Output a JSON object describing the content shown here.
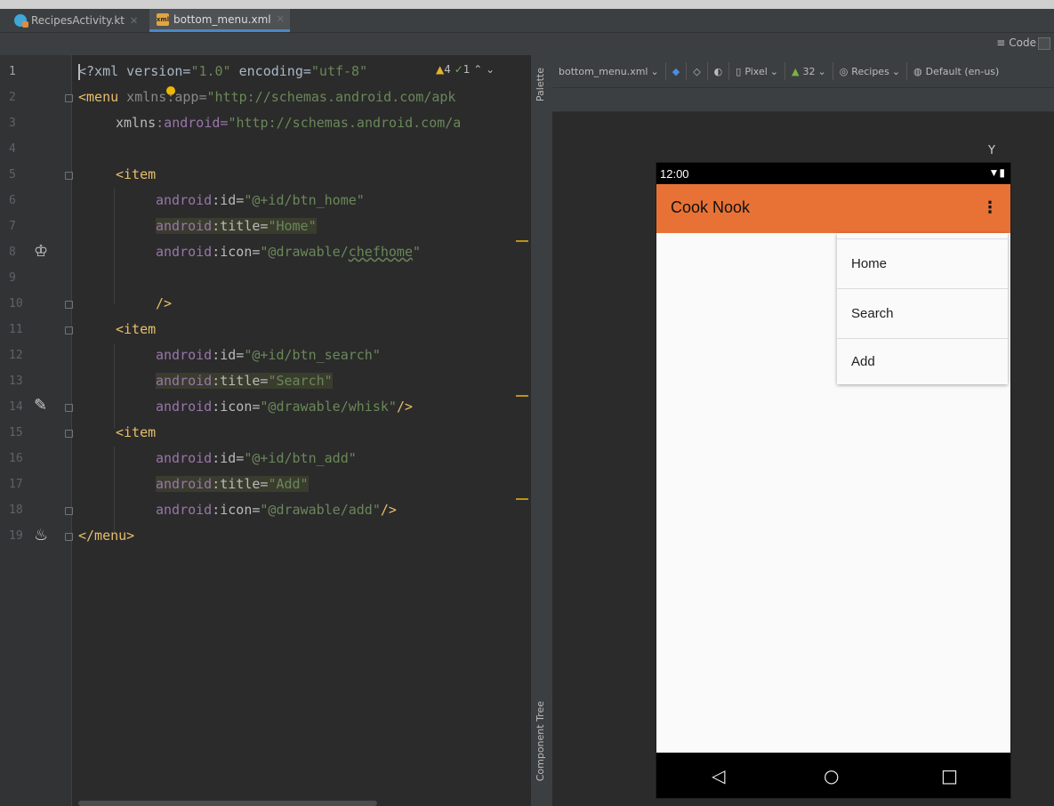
{
  "tabs": [
    {
      "label": "RecipesActivity.kt",
      "active": false
    },
    {
      "label": "bottom_menu.xml",
      "active": true
    }
  ],
  "view_mode": {
    "code_label": "Code"
  },
  "inspections": {
    "warnings": "4",
    "ok": "1"
  },
  "editor": {
    "line_numbers": [
      "1",
      "2",
      "3",
      "4",
      "5",
      "6",
      "7",
      "8",
      "9",
      "10",
      "11",
      "12",
      "13",
      "14",
      "15",
      "16",
      "17",
      "18",
      "19"
    ],
    "lines": {
      "l1": {
        "a": "<?xml version=",
        "b": "\"1.0\"",
        "c": " encoding=",
        "d": "\"utf-8\""
      },
      "l2": {
        "tag": "<menu",
        "ns": " xmlns",
        "attr": ":app=",
        "str": "\"http://schemas.android.com/apk"
      },
      "l3": {
        "ns": "xmlns",
        "attr": ":android=",
        "str": "\"http://schemas.android.com/a"
      },
      "l5": {
        "tag": "<item"
      },
      "l6": {
        "ns": "android",
        "attr": ":id=",
        "str": "\"@+id/btn_home\""
      },
      "l7": {
        "ns": "android",
        "attr": ":title=",
        "str": "\"Home\""
      },
      "l8": {
        "ns": "android",
        "attr": ":icon=",
        "str": "\"@drawable/",
        "str2": "chefhome",
        "str3": "\""
      },
      "l10": {
        "tag": "/>"
      },
      "l11": {
        "tag": "<item"
      },
      "l12": {
        "ns": "android",
        "attr": ":id=",
        "str": "\"@+id/btn_search\""
      },
      "l13": {
        "ns": "android",
        "attr": ":title=",
        "str": "\"Search\""
      },
      "l14": {
        "ns": "android",
        "attr": ":icon=",
        "str": "\"@drawable/whisk\"",
        "tag": "/>"
      },
      "l15": {
        "tag": "<item"
      },
      "l16": {
        "ns": "android",
        "attr": ":id=",
        "str": "\"@+id/btn_add\""
      },
      "l17": {
        "ns": "android",
        "attr": ":title=",
        "str": "\"Add\""
      },
      "l18": {
        "ns": "android",
        "attr": ":icon=",
        "str": "\"@drawable/add\"",
        "tag": "/>"
      },
      "l19": {
        "tag": "</menu>"
      }
    }
  },
  "side_panel": {
    "palette": "Palette",
    "component_tree": "Component Tree"
  },
  "design_toolbar": {
    "file": "bottom_menu.xml",
    "device": "Pixel",
    "api": "32",
    "theme": "Recipes",
    "locale": "Default (en-us)"
  },
  "preview": {
    "status_time": "12:00",
    "app_title": "Cook Nook",
    "menu_items": [
      "Home",
      "Search",
      "Add"
    ]
  }
}
